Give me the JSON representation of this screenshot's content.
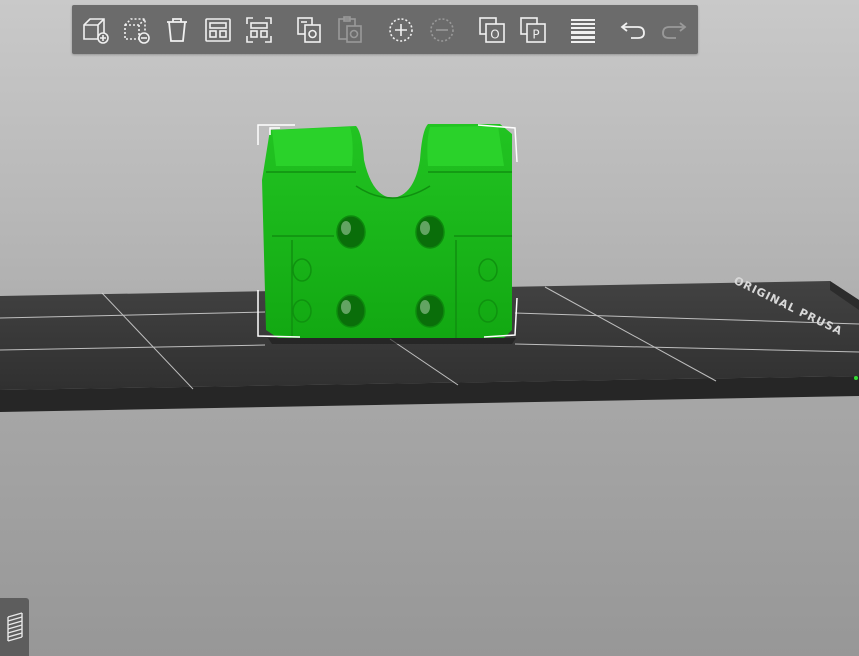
{
  "toolbar": {
    "buttons": [
      {
        "id": "add",
        "icon": "add-object-icon",
        "enabled": true
      },
      {
        "id": "delete-selected",
        "icon": "remove-object-icon",
        "enabled": true
      },
      {
        "id": "delete-all",
        "icon": "trash-icon",
        "enabled": true
      },
      {
        "id": "arrange",
        "icon": "arrange-icon",
        "enabled": true
      },
      {
        "id": "arrange-selection",
        "icon": "arrange-selection-icon",
        "enabled": true
      },
      {
        "id": "copy",
        "icon": "copy-icon",
        "enabled": true
      },
      {
        "id": "paste",
        "icon": "paste-icon",
        "enabled": false
      },
      {
        "id": "add-instance",
        "icon": "add-instance-icon",
        "enabled": true
      },
      {
        "id": "remove-instance",
        "icon": "remove-instance-icon",
        "enabled": false
      },
      {
        "id": "split-objects",
        "icon": "split-to-objects-icon",
        "enabled": true
      },
      {
        "id": "split-parts",
        "icon": "split-to-parts-icon",
        "enabled": true
      },
      {
        "id": "variable-layer-height",
        "icon": "layer-height-icon",
        "enabled": true
      },
      {
        "id": "undo",
        "icon": "undo-icon",
        "enabled": true
      },
      {
        "id": "redo",
        "icon": "redo-icon",
        "enabled": false
      }
    ],
    "split_objects_letter": "O",
    "split_parts_letter": "P"
  },
  "bed": {
    "label": "ORIGINAL PRUSA",
    "surface_color": "#3a3a3a",
    "grid_color": "#d8d8d8"
  },
  "model": {
    "color": "#1fbf1f",
    "selection_color": "#ffffff"
  },
  "sidebar": {
    "layers_icon": "layers-icon"
  }
}
